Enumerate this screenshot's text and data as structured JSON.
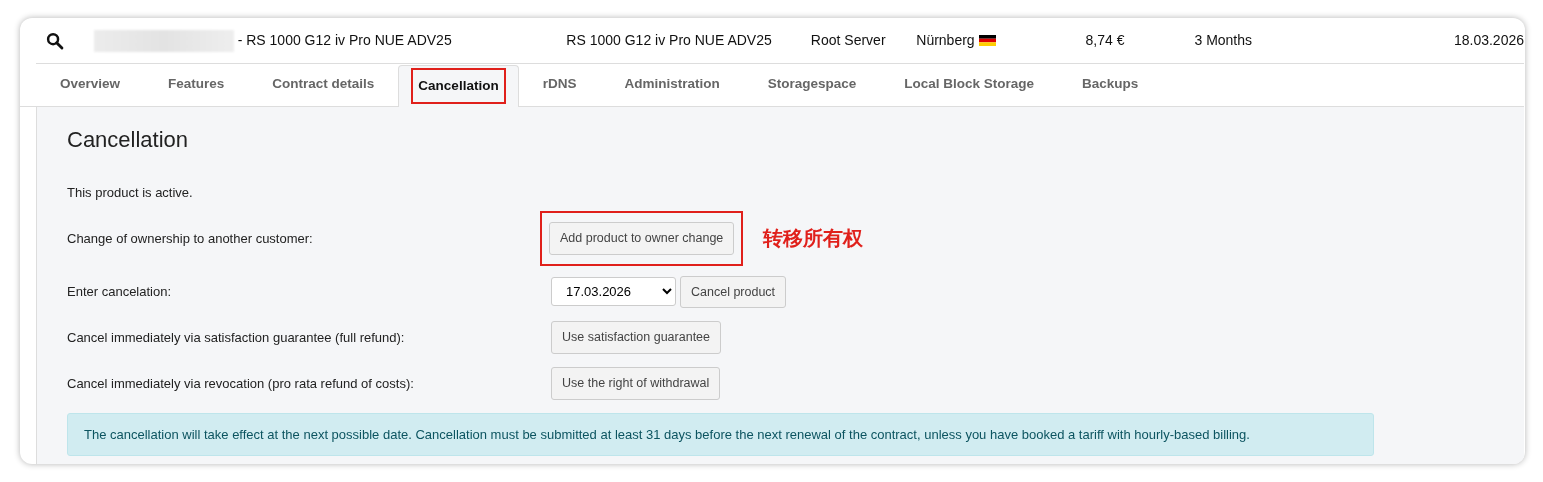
{
  "header": {
    "redacted": true,
    "product_title": "- RS 1000 G12 iv Pro NUE ADV25",
    "product": "RS 1000 G12 iv Pro NUE ADV25",
    "type": "Root Server",
    "location": "Nürnberg",
    "price": "8,74 €",
    "term": "3 Months",
    "date": "18.03.2026"
  },
  "tabs": [
    {
      "label": "Overview",
      "selected": false,
      "highlighted": false
    },
    {
      "label": "Features",
      "selected": false,
      "highlighted": false
    },
    {
      "label": "Contract details",
      "selected": false,
      "highlighted": false
    },
    {
      "label": "Cancellation",
      "selected": true,
      "highlighted": true
    },
    {
      "label": "rDNS",
      "selected": false,
      "highlighted": false
    },
    {
      "label": "Administration",
      "selected": false,
      "highlighted": false
    },
    {
      "label": "Storagespace",
      "selected": false,
      "highlighted": false
    },
    {
      "label": "Local Block Storage",
      "selected": false,
      "highlighted": false
    },
    {
      "label": "Backups",
      "selected": false,
      "highlighted": false
    }
  ],
  "section": {
    "title": "Cancellation",
    "status": "This product is active.",
    "rows": [
      {
        "kind": "button",
        "label": "Change of ownership to another customer:",
        "button": "Add product to owner change",
        "highlighted": true,
        "annotation": "转移所有权"
      },
      {
        "kind": "date_select",
        "label": "Enter cancelation:",
        "value": "17.03.2026",
        "button": "Cancel product",
        "highlighted": false
      },
      {
        "kind": "button",
        "label": "Cancel immediately via satisfaction guarantee (full refund):",
        "button": "Use satisfaction guarantee",
        "highlighted": false
      },
      {
        "kind": "button",
        "label": "Cancel immediately via revocation (pro rata refund of costs):",
        "button": "Use the right of withdrawal",
        "highlighted": false
      }
    ],
    "notice": "The cancellation will take effect at the next possible date. Cancellation must be submitted at least 31 days before the next renewal of the contract, unless you have booked a tariff with hourly-based billing."
  }
}
